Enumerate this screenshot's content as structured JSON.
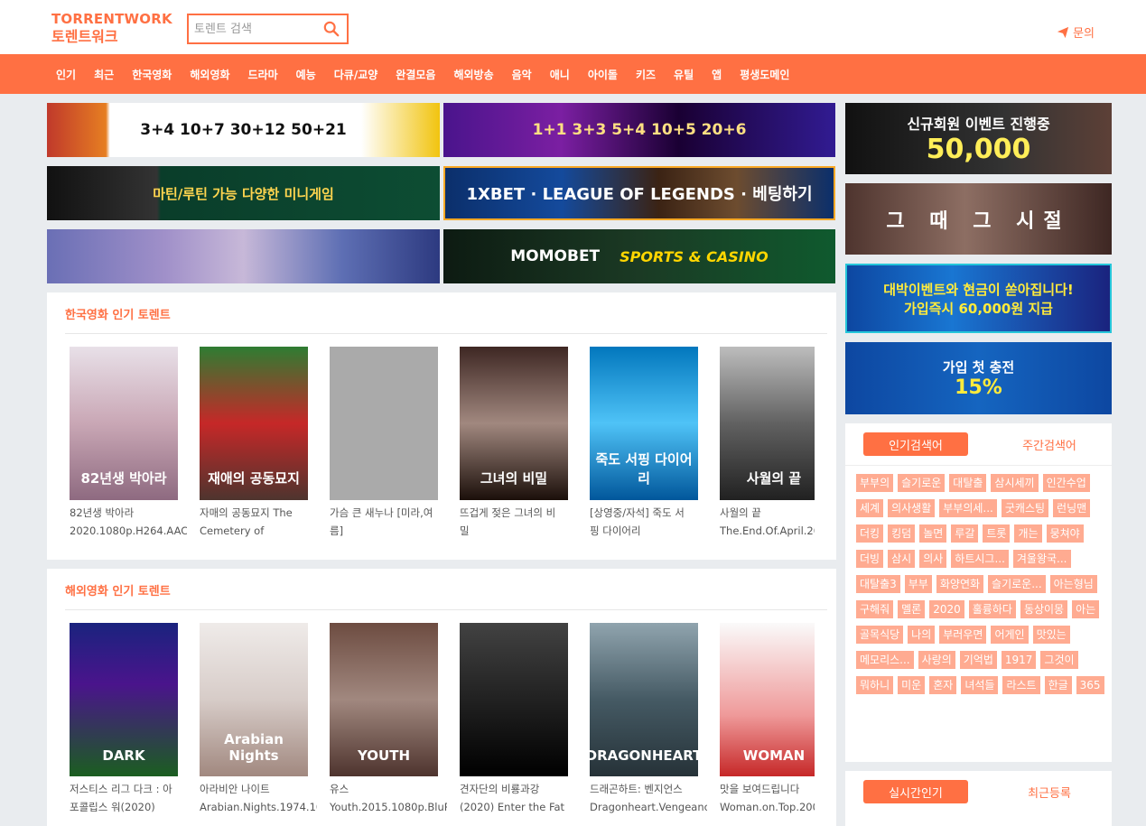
{
  "header": {
    "logo_line1": "TORRENTWORK",
    "logo_line2": "토렌트워크",
    "search_placeholder": "토렌트 검색",
    "contact_label": "문의"
  },
  "nav": {
    "items": [
      "인기",
      "최근",
      "한국영화",
      "해외영화",
      "드라마",
      "예능",
      "다큐/교양",
      "완결모음",
      "해외방송",
      "음악",
      "애니",
      "아이돌",
      "키즈",
      "유틸",
      "앱",
      "평생도메인"
    ]
  },
  "banners": {
    "simba": "3+4 10+7 30+12 50+21",
    "tb": "1+1 3+3 5+4 10+5 20+6",
    "payback": "마틴/루틴 가능 다양한 미니게임",
    "xbet": "1XBET · LEAGUE OF LEGENDS · 베팅하기",
    "momo": "MOMOBET",
    "momo_sports": "SPORTS & CASINO",
    "sr1_top": "신규회원 이벤트 진행중",
    "sr1_amount": "50,000",
    "sr2": "그 때 그 시절",
    "sr3_top": "대박이벤트와 현금이 쏟아집니다!",
    "sr3_bottom": "가입즉시 60,000원 지급",
    "sr4_top": "가입 첫 충전",
    "sr4_pct": "15%"
  },
  "sections": [
    {
      "title": "한국영화 인기 토렌트",
      "cards": [
        {
          "poster": "82년생 박아라",
          "title": "82년생 박아라\n2020.1080p.H264.AAC-"
        },
        {
          "poster": "재애의 공동묘지",
          "title": "자매의 공동묘지 The\nCemetery of"
        },
        {
          "poster": "",
          "title": "가슴 큰 새누나 [미라,여\n름]"
        },
        {
          "poster": "그녀의 비밀",
          "title": "뜨겁게 젖은 그녀의 비\n밀"
        },
        {
          "poster": "죽도 서핑 다이어리",
          "title": "[상영중/자석] 죽도 서\n핑 다이어리"
        },
        {
          "poster": "사월의 끝",
          "title": "사월의 끝\nThe.End.Of.April.20"
        }
      ]
    },
    {
      "title": "해외영화 인기 토렌트",
      "cards": [
        {
          "poster": "DARK",
          "title": "저스티스 리그 다크 : 아\n포콜립스 워(2020)"
        },
        {
          "poster": "Arabian Nights",
          "title": "아라비안 나이트\nArabian.Nights.1974.108"
        },
        {
          "poster": "YOUTH",
          "title": "유스\nYouth.2015.1080p.BluRa"
        },
        {
          "poster": "",
          "title": "견자단의 비룡과강\n(2020) Enter the Fat"
        },
        {
          "poster": "DRAGONHEART",
          "title": "드래곤하트: 벤지언스\nDragonheart.Vengeance"
        },
        {
          "poster": "WOMAN",
          "title": "맛을 보여드립니다\nWoman.on.Top.200"
        }
      ]
    }
  ],
  "keywords": {
    "tab_active": "인기검색어",
    "tab_inactive": "주간검색어",
    "words": [
      "부부의",
      "슬기로운",
      "대탈출",
      "삼시세끼",
      "인간수업",
      "세계",
      "의사생활",
      "부부의세...",
      "굿캐스팅",
      "런닝맨",
      "더킹",
      "킹덤",
      "놀면",
      "루갈",
      "트롯",
      "개는",
      "뭉쳐야",
      "더빙",
      "삼시",
      "의사",
      "하트시그...",
      "겨울왕국...",
      "대탈출3",
      "부부",
      "화양연화",
      "슬기로운...",
      "아는형님",
      "구해줘",
      "멜론",
      "2020",
      "훌륭하다",
      "동상이몽",
      "아는",
      "골목식당",
      "나의",
      "부러우면",
      "어게인",
      "맛있는",
      "메모리스...",
      "사랑의",
      "기억법",
      "1917",
      "그것이",
      "뭐하니",
      "미운",
      "혼자",
      "녀석들",
      "라스트",
      "한글",
      "365"
    ]
  },
  "realtime": {
    "tab_active": "실시간인기",
    "tab_inactive": "최근등록"
  },
  "colors": {
    "accent": "#ff7043",
    "keyword_bg": "#ffab91"
  }
}
